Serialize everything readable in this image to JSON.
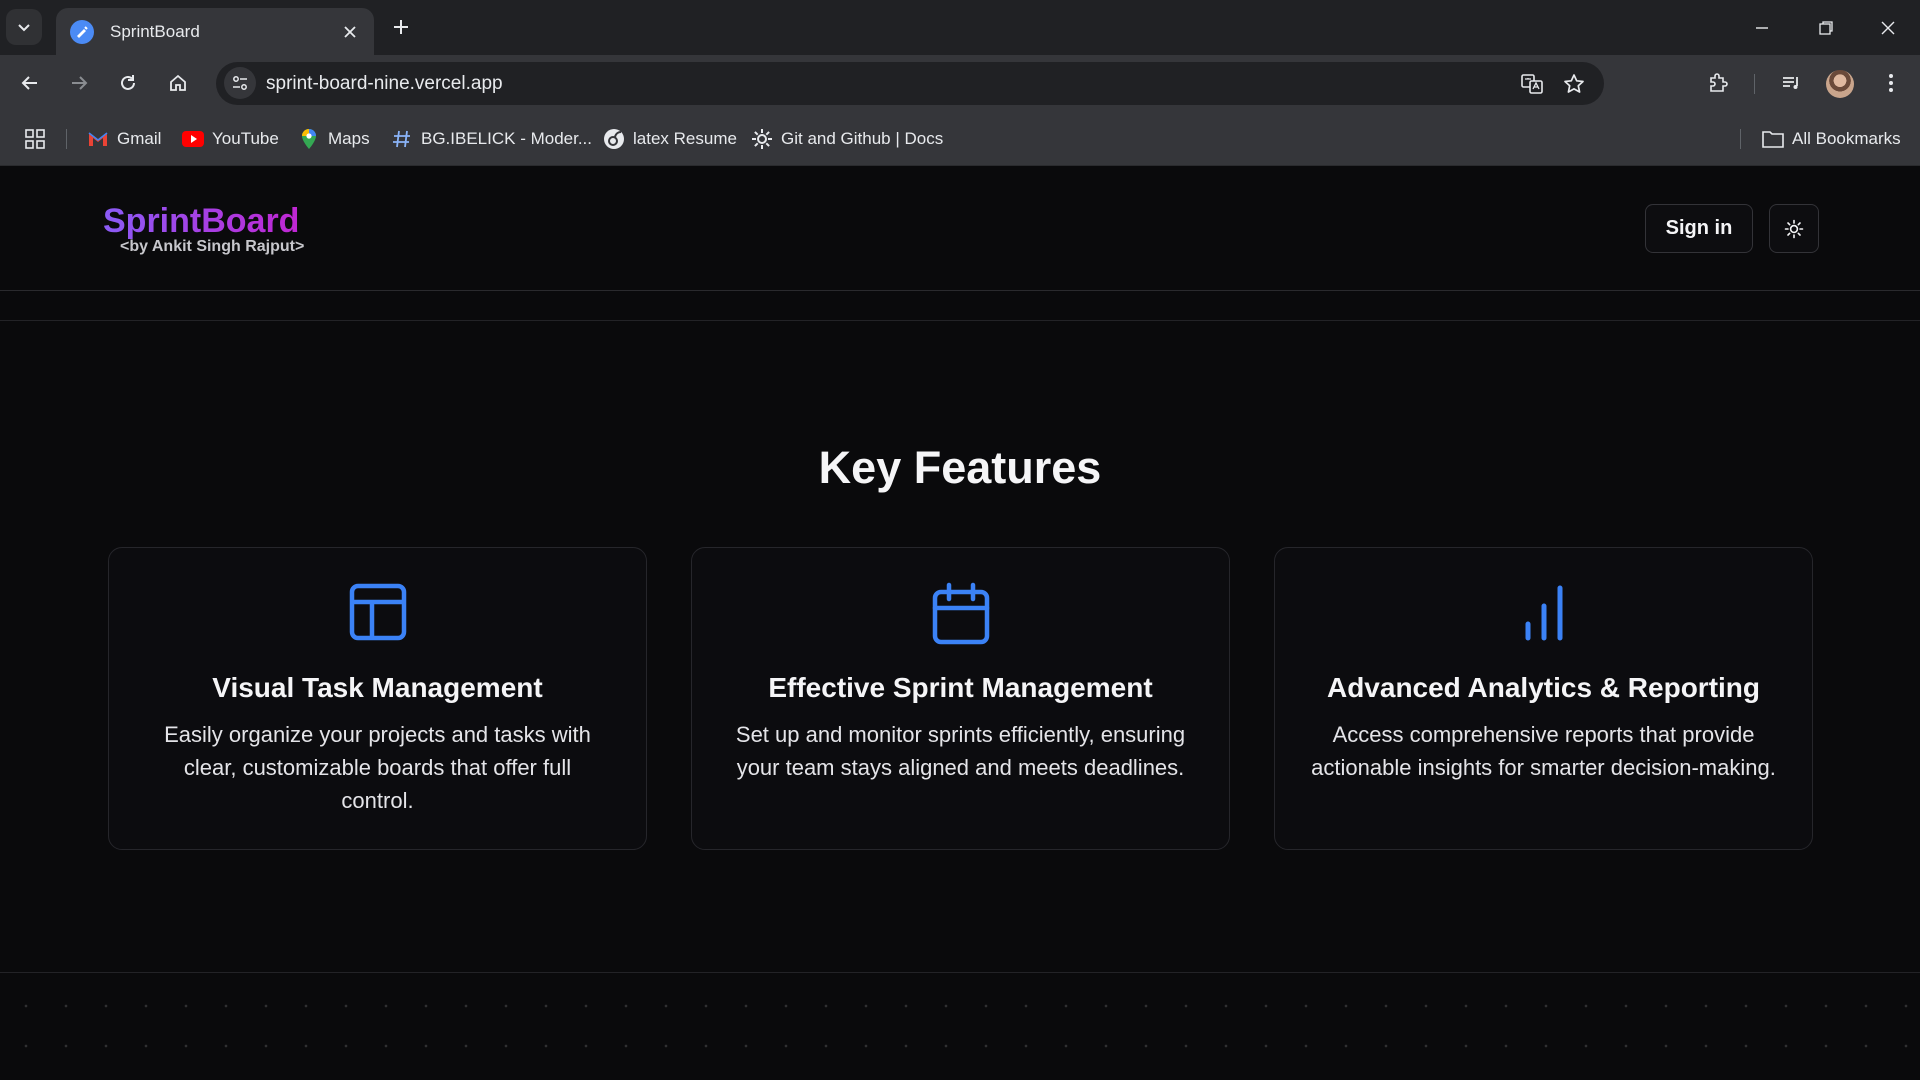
{
  "browser": {
    "tab_title": "SprintBoard",
    "url": "sprint-board-nine.vercel.app",
    "bookmarks": [
      {
        "label": "Gmail"
      },
      {
        "label": "YouTube"
      },
      {
        "label": "Maps"
      },
      {
        "label": "BG.IBELICK - Moder..."
      },
      {
        "label": "latex Resume"
      },
      {
        "label": "Git and Github | Docs"
      }
    ],
    "all_bookmarks": "All Bookmarks"
  },
  "header": {
    "brand": "SprintBoard",
    "brand_sub": "<by Ankit Singh Rajput>",
    "signin_label": "Sign in"
  },
  "features": {
    "title": "Key Features",
    "cards": [
      {
        "icon": "layout-icon",
        "title": "Visual Task Management",
        "desc": "Easily organize your projects and tasks with clear, customizable boards that offer full control."
      },
      {
        "icon": "calendar-icon",
        "title": "Effective Sprint Management",
        "desc": "Set up and monitor sprints efficiently, ensuring your team stays aligned and meets deadlines."
      },
      {
        "icon": "bar-chart-icon",
        "title": "Advanced Analytics & Reporting",
        "desc": "Access comprehensive reports that provide actionable insights for smarter decision-making."
      }
    ]
  },
  "colors": {
    "accent_blue": "#3b82f6",
    "brand_gradient_start": "#8b5cf6",
    "brand_gradient_end": "#c026d3"
  }
}
